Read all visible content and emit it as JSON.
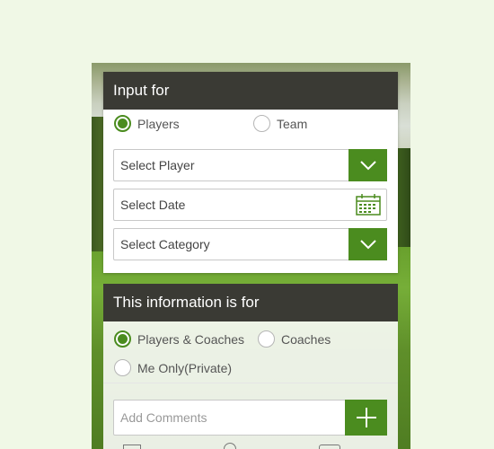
{
  "input_for": {
    "title": "Input for",
    "options": [
      {
        "label": "Players",
        "checked": true
      },
      {
        "label": "Team",
        "checked": false
      }
    ],
    "select_player": "Select Player",
    "select_date": "Select Date",
    "select_category": "Select Category"
  },
  "info_for": {
    "title": "This information is for",
    "options": [
      {
        "label": "Players & Coaches",
        "checked": true
      },
      {
        "label": "Coaches",
        "checked": false
      },
      {
        "label": "Me Only(Private)",
        "checked": false
      }
    ],
    "comments_placeholder": "Add Comments"
  },
  "colors": {
    "accent": "#4b8c1f",
    "header_bg": "#3a3a34",
    "page_bg": "#f0f8e6"
  },
  "icons": [
    "chevron-down-icon",
    "calendar-icon",
    "plus-icon"
  ]
}
